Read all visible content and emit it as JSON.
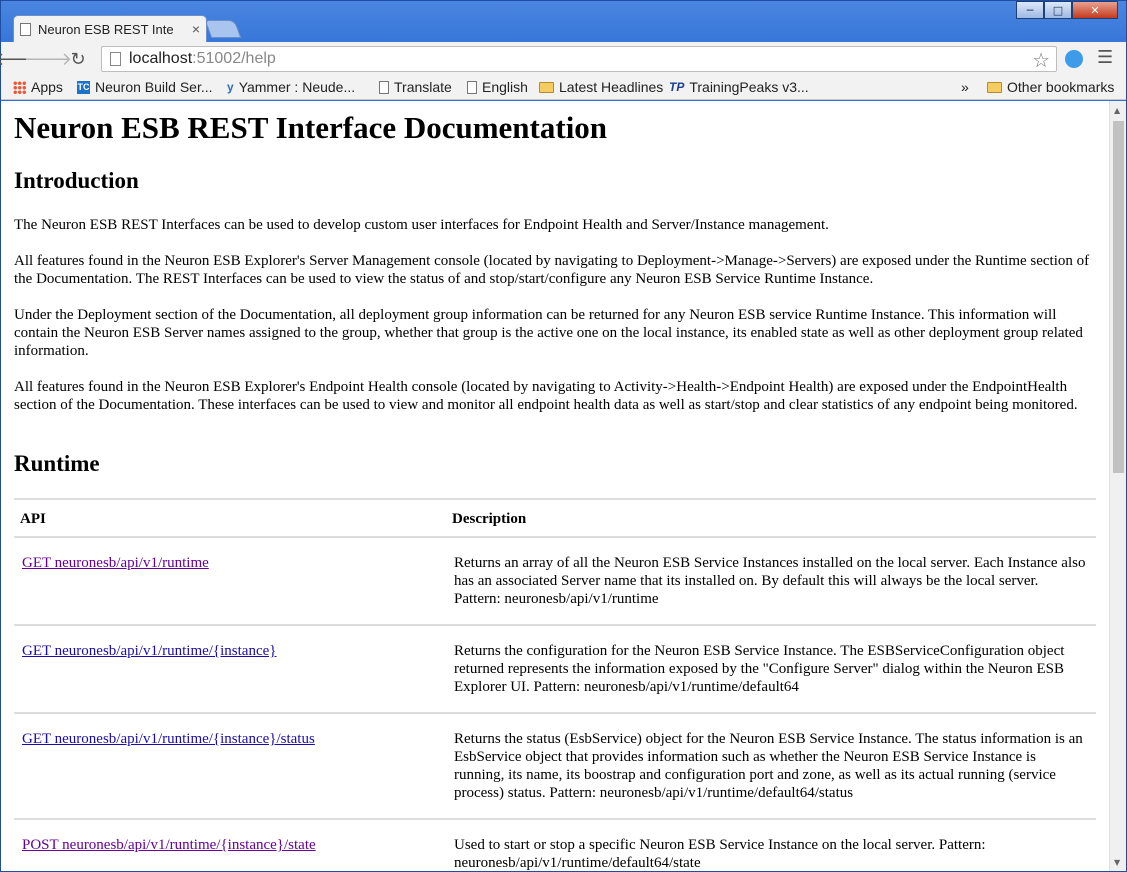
{
  "browser": {
    "tab_title": "Neuron ESB REST Inte",
    "tab_close": "×",
    "url_host": "localhost",
    "url_path": ":51002/help",
    "bookmarks": [
      {
        "icon": "apps-icon",
        "label": "Apps"
      },
      {
        "icon": "teamcity-icon",
        "label": "Neuron Build Ser..."
      },
      {
        "icon": "yammer-icon",
        "label": "Yammer : Neude..."
      },
      {
        "icon": "page-icon",
        "label": "Translate"
      },
      {
        "icon": "page-icon",
        "label": "English"
      },
      {
        "icon": "folder-icon",
        "label": "Latest Headlines"
      },
      {
        "icon": "trainingpeaks-icon",
        "label": "TrainingPeaks v3..."
      }
    ],
    "overflow": "»",
    "other_bookmarks": "Other bookmarks"
  },
  "page": {
    "title": "Neuron ESB REST Interface Documentation",
    "intro_heading": "Introduction",
    "paragraphs": [
      "The Neuron ESB REST Interfaces can be used to develop custom user interfaces for Endpoint Health and Server/Instance management.",
      "All features found in the Neuron ESB Explorer's Server Management console (located by navigating to Deployment->Manage->Servers) are exposed under the Runtime section of the Documentation. The REST Interfaces can be used to view the status of and stop/start/configure any Neuron ESB Service Runtime Instance.",
      "Under the Deployment section of the Documentation, all deployment group information can be returned for any Neuron ESB service Runtime Instance. This information will contain the Neuron ESB Server names assigned to the group, whether that group is the active one on the local instance, its enabled state as well as other deployment group related information.",
      "All features found in the Neuron ESB Explorer's Endpoint Health console (located by navigating to Activity->Health->Endpoint Health) are exposed under the EndpointHealth section of the Documentation. These interfaces can be used to view and monitor all endpoint health data as well as start/stop and clear statistics of any endpoint being monitored."
    ],
    "runtime_heading": "Runtime",
    "table": {
      "headers": [
        "API",
        "Description"
      ],
      "rows": [
        {
          "api": "GET neuronesb/api/v1/runtime",
          "description": "Returns an array of all the Neuron ESB Service Instances installed on the local server. Each Instance also has an associated Server name that its installed on. By default this will always be the local server. Pattern: neuronesb/api/v1/runtime"
        },
        {
          "api": "GET neuronesb/api/v1/runtime/{instance}",
          "description": "Returns the configuration for the Neuron ESB Service Instance. The ESBServiceConfiguration object returned represents the information exposed by the \"Configure Server\" dialog within the Neuron ESB Explorer UI. Pattern: neuronesb/api/v1/runtime/default64"
        },
        {
          "api": "GET neuronesb/api/v1/runtime/{instance}/status",
          "description": "Returns the status (EsbService) object for the Neuron ESB Service Instance. The status information is an EsbService object that provides information such as whether the Neuron ESB Service Instance is running, its name, its boostrap and configuration port and zone, as well as its actual running (service process) status. Pattern: neuronesb/api/v1/runtime/default64/status"
        },
        {
          "api": "POST neuronesb/api/v1/runtime/{instance}/state",
          "description": "Used to start or stop a specific Neuron ESB Service Instance on the local server. Pattern: neuronesb/api/v1/runtime/default64/state"
        }
      ]
    }
  }
}
